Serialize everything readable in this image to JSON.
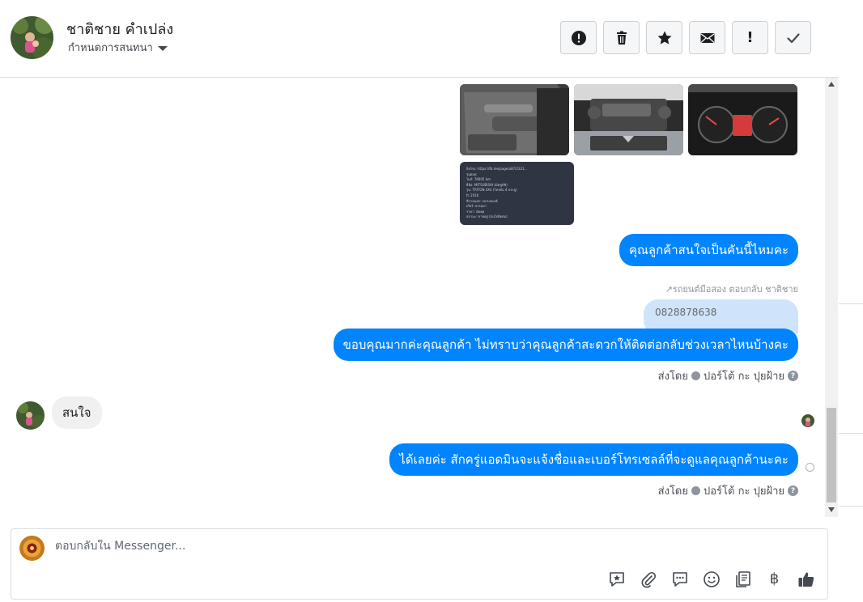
{
  "header": {
    "contact_name": "ชาติชาย คำเปล่ง",
    "assign_label": "กำหนดการสนทนา",
    "toolbar": [
      {
        "name": "report-button",
        "icon": "alert-circle-icon"
      },
      {
        "name": "delete-button",
        "icon": "trash-icon"
      },
      {
        "name": "star-button",
        "icon": "star-icon"
      },
      {
        "name": "mark-unread-button",
        "icon": "envelope-icon"
      },
      {
        "name": "spam-button",
        "icon": "exclamation-icon"
      },
      {
        "name": "done-button",
        "icon": "checkmark-icon"
      }
    ]
  },
  "conversation": {
    "doc_image_lines": [
      "ลิงก์รถ:  https://fb.me/page/a87/2321...",
      "รุ่นย่อย:",
      "ไมล์:      78005 km",
      "ยี่ห้อ:     MITSUBISHI (มิตซูบิชิ)",
      "รุ่น:       TRITON 4X4 (ไทรทัน 4 ประตู)",
      "ปี:        2016",
      "สีภายนอก:  เทาบรอนซ์",
      "เกียร์:     ธรรมดา",
      "ราคา:     นัดคุย",
      "สถานะ:   ขายอยู่ (สนใจติดต่อ)"
    ],
    "msg_question": "คุณลูกค้าสนใจเป็นคันนี้ไหมคะ",
    "reply_context": "รถยนต์มือสอง ตอบกลับ ชาติชาย",
    "phone_quote": "0828878638",
    "msg_thanks": "ขอบคุณมากค่ะคุณลูกค้า ไม่ทราบว่าคุณลูกค้าสะดวกให้ติดต่อกลับช่วงเวลาไหนบ้างคะ",
    "sent_by_1": "ส่งโดย",
    "sender_1": "ปอร์โต้ กะ ปุยฝ้าย",
    "msg_incoming": "สนใจ",
    "msg_final": "ได้เลยค่ะ สักครู่แอดมินจะแจ้งชื่อและเบอร์โทรเซลล์ที่จะดูแลคุณลูกค้านะคะ",
    "sent_by_2": "ส่งโดย",
    "sender_2": "ปอร์โต้ กะ ปุยฝ้าย",
    "help_glyph": "?"
  },
  "composer": {
    "placeholder": "ตอบกลับใน Messenger...",
    "value": "",
    "tools": [
      {
        "name": "saved-reply-button",
        "icon": "star-bubble-icon"
      },
      {
        "name": "attach-button",
        "icon": "paperclip-icon"
      },
      {
        "name": "quick-reply-button",
        "icon": "chat-bubble-icon"
      },
      {
        "name": "emoji-button",
        "icon": "smiley-icon"
      },
      {
        "name": "catalog-button",
        "icon": "book-icon"
      },
      {
        "name": "payment-button",
        "icon": "baht-icon",
        "glyph": "฿"
      },
      {
        "name": "like-button",
        "icon": "thumbs-up-icon"
      }
    ]
  },
  "colors": {
    "accent": "#0084ff",
    "incoming_bubble": "#f1f0f0",
    "quote_bubble": "#cfe4fb"
  }
}
